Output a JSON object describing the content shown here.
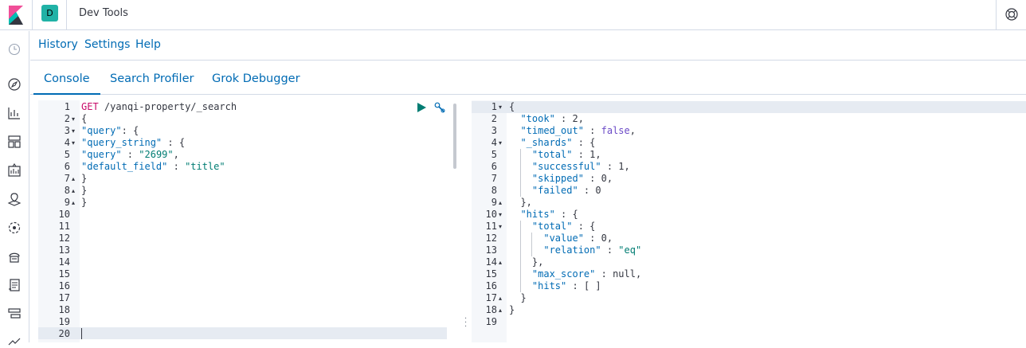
{
  "header": {
    "space_initial": "D",
    "app_title": "Dev Tools"
  },
  "menu": {
    "history": "History",
    "settings": "Settings",
    "help": "Help"
  },
  "tabs": [
    {
      "label": "Console",
      "active": true
    },
    {
      "label": "Search Profiler",
      "active": false
    },
    {
      "label": "Grok Debugger",
      "active": false
    }
  ],
  "colors": {
    "accent": "#006bb4",
    "badge": "#20b2a6",
    "method": "#c80a68",
    "key": "#006bb4",
    "string": "#017d73",
    "boolean": "#6b4ac7"
  },
  "icons": {
    "run": "play-icon",
    "settings": "wrench-icon",
    "help": "lifebuoy-icon"
  },
  "request": {
    "line_numbers": [
      "1",
      "2",
      "3",
      "4",
      "5",
      "6",
      "7",
      "8",
      "9",
      "10",
      "11",
      "12",
      "13",
      "14",
      "15",
      "16",
      "17",
      "18",
      "19",
      "20"
    ],
    "method": "GET",
    "path": "/yanqi-property/_search",
    "l2": "{",
    "l3_key": "\"query\"",
    "l3_rest": ": {",
    "l4_key": "\"query_string\"",
    "l4_rest": " : {",
    "l5_key": "\"query\"",
    "l5_colon": " : ",
    "l5_val": "\"2699\"",
    "l5_comma": ",",
    "l6_key": "\"default_field\"",
    "l6_colon": " : ",
    "l6_val": "\"title\"",
    "l7": "}",
    "l8": "}",
    "l9": "}"
  },
  "response": {
    "line_numbers": [
      "1",
      "2",
      "3",
      "4",
      "5",
      "6",
      "7",
      "8",
      "9",
      "10",
      "11",
      "12",
      "13",
      "14",
      "15",
      "16",
      "17",
      "18",
      "19"
    ],
    "r1": "{",
    "r2_key": "\"took\"",
    "r2_rest": " : 2,",
    "r3_key": "\"timed_out\"",
    "r3_colon": " : ",
    "r3_val": "false",
    "r3_comma": ",",
    "r4_key": "\"_shards\"",
    "r4_rest": " : {",
    "r5_key": "\"total\"",
    "r5_rest": " : 1,",
    "r6_key": "\"successful\"",
    "r6_rest": " : 1,",
    "r7_key": "\"skipped\"",
    "r7_rest": " : 0,",
    "r8_key": "\"failed\"",
    "r8_rest": " : 0",
    "r9": "},",
    "r10_key": "\"hits\"",
    "r10_rest": " : {",
    "r11_key": "\"total\"",
    "r11_rest": " : {",
    "r12_key": "\"value\"",
    "r12_rest": " : 0,",
    "r13_key": "\"relation\"",
    "r13_colon": " : ",
    "r13_val": "\"eq\"",
    "r14": "},",
    "r15_key": "\"max_score\"",
    "r15_rest": " : null,",
    "r16_key": "\"hits\"",
    "r16_rest": " : [ ]",
    "r17": "}",
    "r18": "}"
  }
}
